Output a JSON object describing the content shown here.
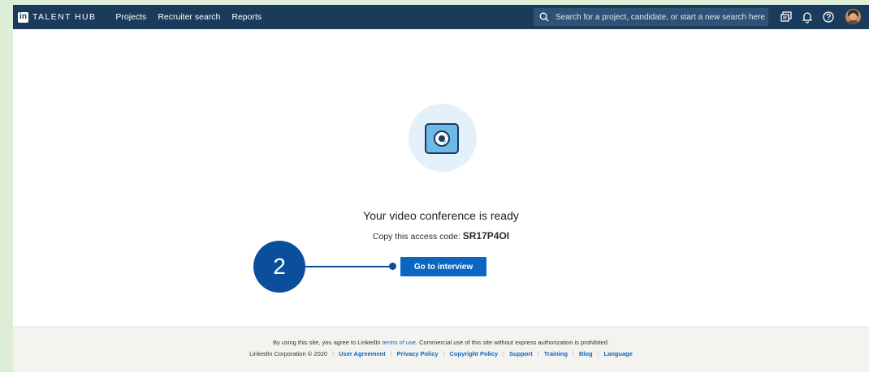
{
  "nav": {
    "logo_letters": "in",
    "brand": "TALENT HUB",
    "links": [
      "Projects",
      "Recruiter search",
      "Reports"
    ],
    "search_placeholder": "Search for a project, candidate, or start a new search here",
    "icons": [
      "messages-icon",
      "notifications-bell-icon",
      "help-icon",
      "avatar"
    ]
  },
  "main": {
    "title": "Your video conference is ready",
    "code_prefix": "Copy this access code: ",
    "access_code": "SR17P4OI",
    "button_label": "Go to interview"
  },
  "callout": {
    "number": "2"
  },
  "footer": {
    "line1_prefix": "By using this site, you agree to LinkedIn ",
    "terms_link": "terms of use",
    "line1_suffix": ". Commercial use of this site without express authorization is prohibited.",
    "copyright": "LinkedIn Corporation © 2020",
    "links": [
      "User Agreement",
      "Privacy Policy",
      "Copyright Policy",
      "Support",
      "Training",
      "Blog",
      "Language"
    ]
  },
  "colors": {
    "nav_bg": "#1b3b5c",
    "button": "#0a66c2",
    "callout": "#0b4f9c",
    "outer_bg": "#dcedd8"
  }
}
